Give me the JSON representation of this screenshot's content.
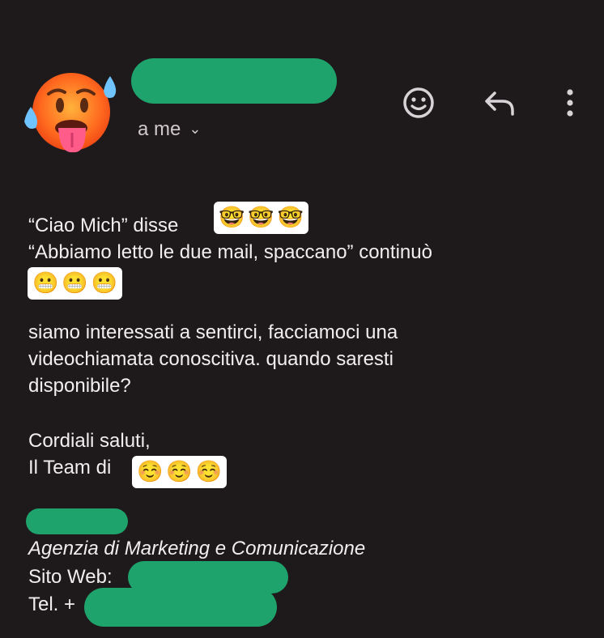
{
  "header": {
    "recipient_label": "a me",
    "chevron": "⌄",
    "icons": {
      "avatar": "hot-face-emoji",
      "react": "smile-icon",
      "reply": "reply-icon",
      "more": "more-vert-icon"
    }
  },
  "message": {
    "line1_text": "“Ciao Mich” disse",
    "line1_emojis": [
      "🤓",
      "🤓",
      "🤓"
    ],
    "line2_text": "“Abbiamo letto le due mail, spaccano” continuò",
    "line2_emojis": [
      "😬",
      "😬",
      "😬"
    ],
    "para2_line1": "siamo interessati a sentirci, facciamoci una",
    "para2_line2": "videochiamata conoscitiva. quando saresti",
    "para2_line3": "disponibile?",
    "closing": "Cordiali saluti,",
    "team_text": "Il Team di",
    "team_emojis": [
      "☺️",
      "☺️",
      "☺️"
    ]
  },
  "signature": {
    "agency": "Agenzia di Marketing e Comunicazione",
    "website_label": "Sito Web:",
    "phone_label": "Tel. +"
  },
  "colors": {
    "background": "#1e1a1c",
    "redaction": "#1fa36c",
    "text": "#f2eef0"
  }
}
